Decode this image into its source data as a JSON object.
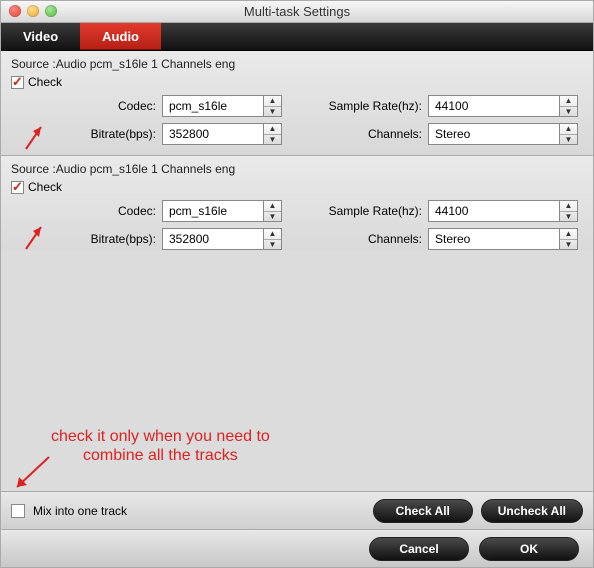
{
  "window": {
    "title": "Multi-task Settings"
  },
  "tabs": {
    "video": "Video",
    "audio": "Audio",
    "active": "audio"
  },
  "tracks": [
    {
      "source_line": "Source :Audio  pcm_s16le  1 Channels  eng",
      "check_label": "Check",
      "codec_label": "Codec:",
      "codec_value": "pcm_s16le",
      "bitrate_label": "Bitrate(bps):",
      "bitrate_value": "352800",
      "samplerate_label": "Sample Rate(hz):",
      "samplerate_value": "44100",
      "channels_label": "Channels:",
      "channels_value": "Stereo"
    },
    {
      "source_line": "Source :Audio  pcm_s16le  1 Channels  eng",
      "check_label": "Check",
      "codec_label": "Codec:",
      "codec_value": "pcm_s16le",
      "bitrate_label": "Bitrate(bps):",
      "bitrate_value": "352800",
      "samplerate_label": "Sample Rate(hz):",
      "samplerate_value": "44100",
      "channels_label": "Channels:",
      "channels_value": "Stereo"
    }
  ],
  "mix": {
    "label": "Mix into one track"
  },
  "buttons": {
    "check_all": "Check All",
    "uncheck_all": "Uncheck All",
    "cancel": "Cancel",
    "ok": "OK"
  },
  "annotations": {
    "combine_line1": "check it only when you need to",
    "combine_line2": "combine all the tracks"
  }
}
